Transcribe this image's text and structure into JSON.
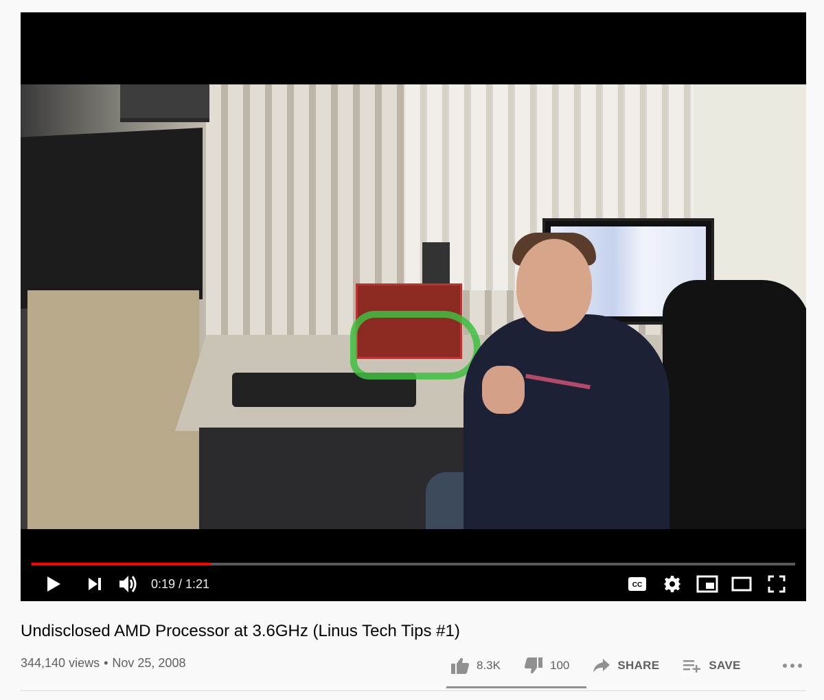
{
  "video": {
    "title": "Undisclosed AMD Processor at 3.6GHz (Linus Tech Tips #1)",
    "views": "344,140 views",
    "separator": "•",
    "date": "Nov 25, 2008"
  },
  "player": {
    "current_time": "0:19",
    "duration": "1:21",
    "time_display": "0:19 / 1:21",
    "progress_fraction": 0.2346,
    "progress_color": "#ff0000",
    "icons": {
      "play": "play-icon",
      "next": "next-icon",
      "volume": "volume-icon",
      "captions": "closed-captions-icon",
      "settings": "gear-icon",
      "miniplayer": "miniplayer-icon",
      "theater": "theater-mode-icon",
      "fullscreen": "fullscreen-icon"
    }
  },
  "actions": {
    "like_count": "8.3K",
    "dislike_count": "100",
    "share_label": "SHARE",
    "save_label": "SAVE",
    "like_ratio": 0.988
  }
}
